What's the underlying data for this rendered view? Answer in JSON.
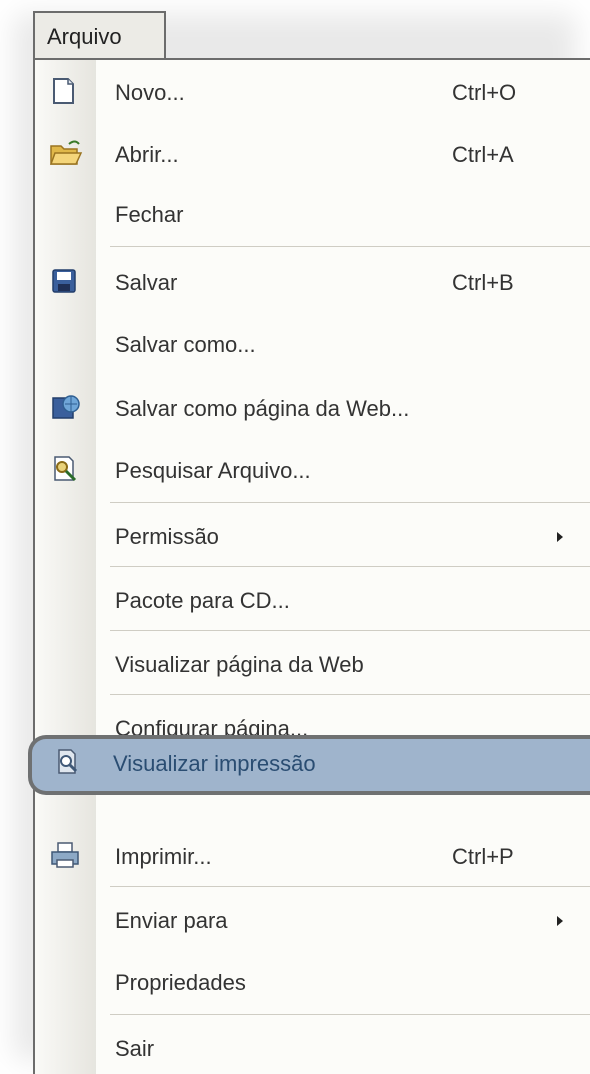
{
  "menu": {
    "title": "Arquivo",
    "items": [
      {
        "label": "Novo...",
        "shortcut": "Ctrl+O",
        "icon": "new-document-icon"
      },
      {
        "label": "Abrir...",
        "shortcut": "Ctrl+A",
        "icon": "open-folder-icon"
      },
      {
        "label": "Fechar"
      },
      {
        "label": "Salvar",
        "shortcut": "Ctrl+B",
        "icon": "save-disk-icon"
      },
      {
        "label": "Salvar como..."
      },
      {
        "label": "Salvar como página da Web...",
        "icon": "web-page-icon"
      },
      {
        "label": "Pesquisar Arquivo...",
        "icon": "file-search-icon"
      },
      {
        "label": "Permissão",
        "submenu": true
      },
      {
        "label": "Pacote para CD..."
      },
      {
        "label": "Visualizar página da Web"
      },
      {
        "label": "Configurar página..."
      },
      {
        "label": "Visualizar impressão",
        "icon": "print-preview-icon",
        "highlighted": true
      },
      {
        "label": "Imprimir...",
        "shortcut": "Ctrl+P",
        "icon": "printer-icon"
      },
      {
        "label": "Enviar para",
        "submenu": true
      },
      {
        "label": "Propriedades"
      },
      {
        "label": "Sair"
      }
    ]
  },
  "colors": {
    "highlight": "#9fb4cc",
    "menu_background": "#fcfcf9",
    "border": "#6c6c6c"
  }
}
